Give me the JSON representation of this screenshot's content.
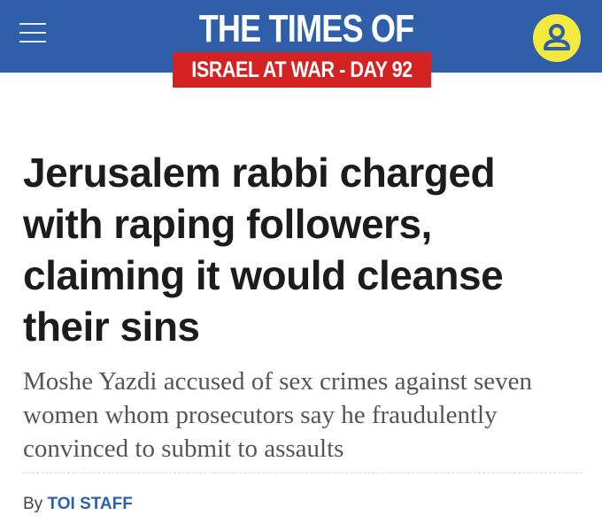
{
  "header": {
    "logo": "THE TIMES OF ISRAEL",
    "badge": "ISRAEL AT WAR - DAY 92",
    "colors": {
      "bar": "#2f5fa8",
      "badge": "#d42222",
      "user_icon": "#f3ea3f"
    },
    "icons": {
      "menu": "hamburger-menu-icon",
      "user": "user-account-icon"
    }
  },
  "article": {
    "headline": "Jerusalem rabbi charged with raping followers, claiming it would cleanse their sins",
    "subhead": "Moshe Yazdi accused of sex crimes against seven women whom prosecutors say he fraudulently convinced to submit to assaults",
    "byline_prefix": "By",
    "author": "TOI STAFF"
  }
}
